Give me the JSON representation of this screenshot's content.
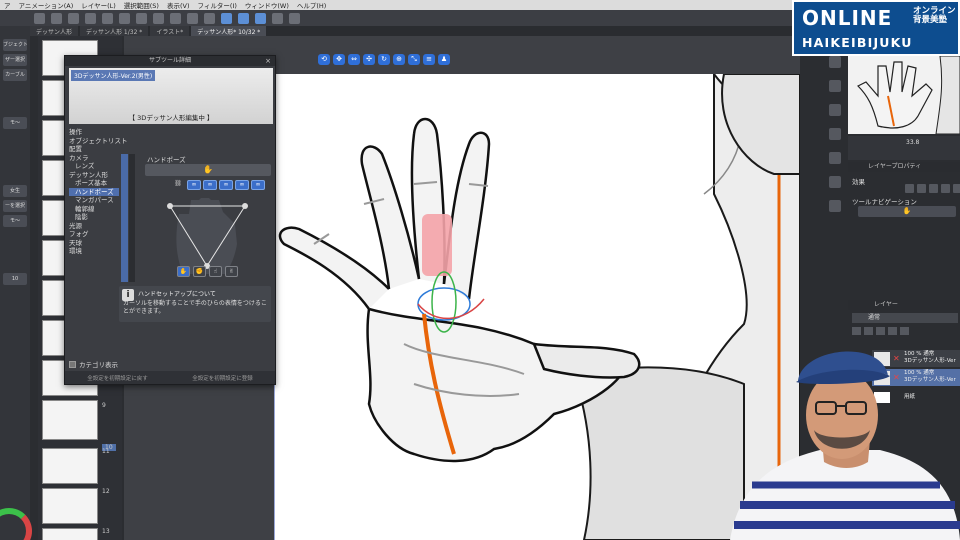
{
  "menubar": {
    "items": [
      "ア",
      "アニメーション(A)",
      "レイヤー(L)",
      "選択範囲(S)",
      "表示(V)",
      "フィルター(I)",
      "ウィンドウ(W)",
      "ヘルプ(H)"
    ]
  },
  "tabs": [
    {
      "label": "デッサン人形"
    },
    {
      "label": "デッサン人形 1/32 *"
    },
    {
      "label": "イラスト*"
    },
    {
      "label": "デッサン人形* 10/32 *"
    }
  ],
  "toolbox": {
    "items": [
      "ブジェクト",
      "ザー選択",
      "カーブル",
      "モ〜",
      "女生",
      "ーを選択",
      "モ〜",
      "10"
    ]
  },
  "pages": {
    "numbers": [
      "9",
      "10",
      "11",
      "12",
      "13"
    ],
    "selected": "10"
  },
  "dialog": {
    "title": "サブツール詳細",
    "close": "×",
    "preview_name": "3Dデッサン人形-Ver.2(男性)",
    "preview_status": "【 3Dデッサン人形編集中 】",
    "categories": [
      "操作",
      "オブジェクトリスト",
      "配置",
      "カメラ",
      "レンズ",
      "デッサン人形",
      "ポーズ基本",
      "ハンドポーズ",
      "マンガパース",
      "輪郭線",
      "陰影",
      "光源",
      "フォグ",
      "天球",
      "環境"
    ],
    "selected_category": "ハンドポーズ",
    "section_label": "ハンドポーズ",
    "hand_buttons": [
      "∞",
      "∞",
      "∞",
      "∞",
      "∞"
    ],
    "info_title": "ハンドセットアップについて",
    "info_text": "カーソルを移動することで手のひらの表情をつけることができます。",
    "category_toggle": "カテゴリ表示",
    "footer_left": "全設定を初期設定に戻す",
    "footer_right": "全設定を初期設定に登録"
  },
  "right_panel": {
    "zoom": "33.8",
    "layer_property_title": "レイヤープロパティ",
    "effect_label": "効果",
    "tool_nav_label": "ツールナビゲーション",
    "layer_title": "レイヤー",
    "blend_mode": "通常",
    "layers": [
      {
        "name_line1": "100 % 通常",
        "name_line2": "3Dデッサン人形-Ver",
        "selected": false
      },
      {
        "name_line1": "100 % 通常",
        "name_line2": "3Dデッサン人形-Ver",
        "selected": true
      }
    ],
    "paper_layer": "用紙"
  },
  "logo": {
    "main": "ONLINE",
    "jp_line1": "オンライン",
    "jp_line2": "背景美塾",
    "sub": "HAIKEIBIJUKU"
  },
  "colors": {
    "accent_blue": "#2f6fd8",
    "selection_blue": "#4f6fae",
    "logo_blue": "#0d4d8f",
    "guide_orange": "#e8650a",
    "finger_highlight": "#f4a3a8"
  }
}
